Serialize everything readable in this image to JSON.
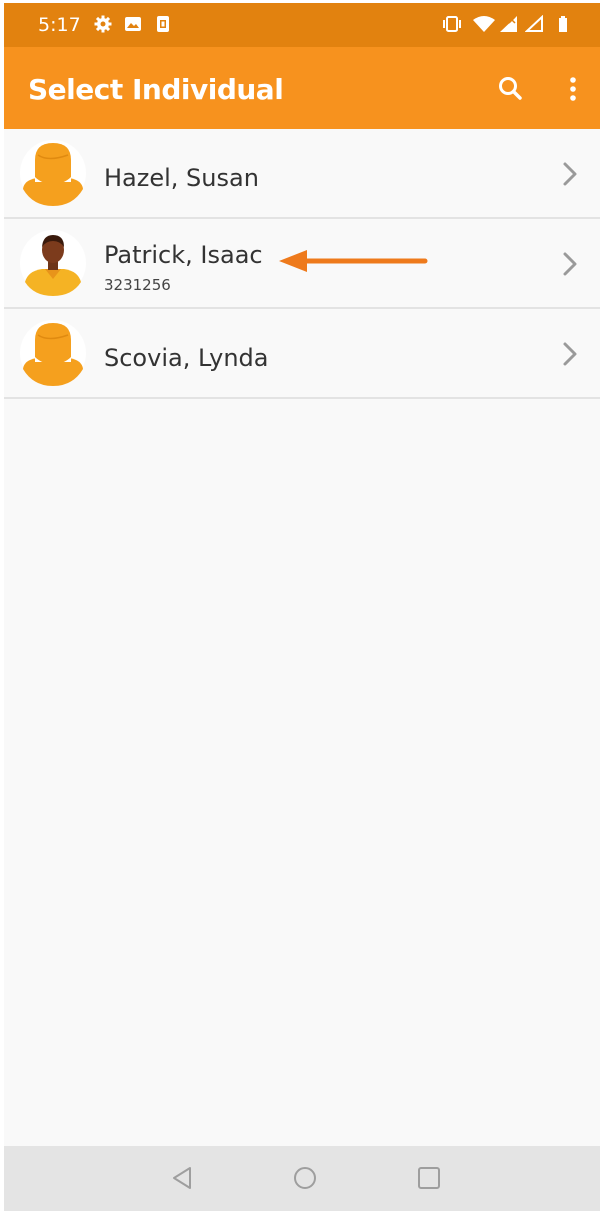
{
  "status_bar": {
    "time": "5:17",
    "background": "#e2820f",
    "icons": [
      "gear-icon",
      "image-icon",
      "sim-icon",
      "vibrate-icon",
      "wifi-icon",
      "cell-signal-icon",
      "cell-signal-empty-icon",
      "battery-icon"
    ]
  },
  "app_bar": {
    "title": "Select Individual",
    "background": "#f7921e",
    "actions": [
      "search-icon",
      "more-vert-icon"
    ]
  },
  "individuals": [
    {
      "name": "Hazel, Susan",
      "id_number": "",
      "avatar": "placeholder-avatar-icon"
    },
    {
      "name": "Patrick, Isaac",
      "id_number": "3231256",
      "avatar": "person-photo-avatar-icon"
    },
    {
      "name": "Scovia, Lynda",
      "id_number": "",
      "avatar": "placeholder-avatar-icon"
    }
  ],
  "annotation": {
    "icon": "pointer-arrow-icon",
    "color": "#ee7a1c"
  },
  "nav_bar": {
    "buttons": [
      "back-icon",
      "home-icon",
      "recents-icon"
    ]
  },
  "colors": {
    "accent": "#f7921e",
    "avatar": "#f5a01e",
    "divider": "#e3e3e3"
  }
}
